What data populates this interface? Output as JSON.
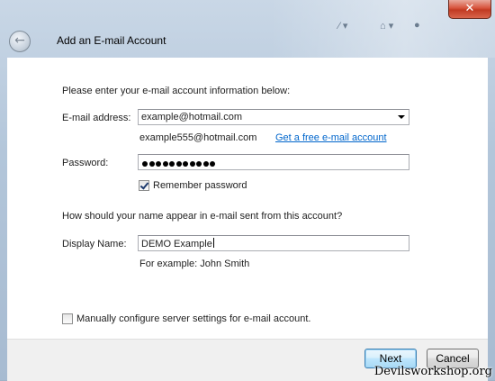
{
  "window": {
    "title": "Add an E-mail Account",
    "close_glyph": "✕",
    "back_glyph": "←"
  },
  "background_toolbar": {
    "items": [
      "⁄ ▾",
      "⌂ ▾",
      "●"
    ]
  },
  "intro": "Please enter your e-mail account information below:",
  "email": {
    "label": "E-mail address:",
    "value": "example@hotmail.com",
    "suggestion": "example555@hotmail.com",
    "free_account_link": "Get a free e-mail account"
  },
  "password": {
    "label": "Password:",
    "masked_length": 11,
    "remember_label": "Remember password",
    "remember_checked": true
  },
  "name_question": "How should your name appear in e-mail sent from this account?",
  "display_name": {
    "label": "Display Name:",
    "value": "DEMO Example",
    "hint": "For example: John Smith"
  },
  "manual_config": {
    "label": "Manually configure server settings for e-mail account.",
    "checked": false
  },
  "buttons": {
    "next": "Next",
    "cancel": "Cancel"
  },
  "watermark": "Devilsworkshop.org",
  "colors": {
    "link": "#0066cc",
    "close_button": "#c13a22",
    "default_button_border": "#3c7fb1"
  }
}
